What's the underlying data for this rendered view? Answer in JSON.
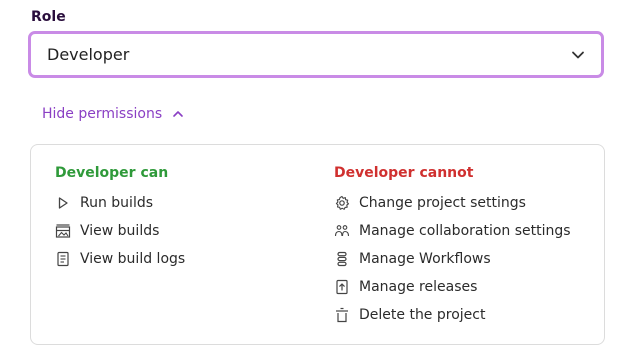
{
  "role": {
    "label": "Role",
    "selected": "Developer"
  },
  "toggle": {
    "label": "Hide permissions"
  },
  "permissions": {
    "can_heading": "Developer can",
    "cannot_heading": "Developer cannot",
    "can": [
      {
        "icon": "play-icon",
        "label": "Run builds"
      },
      {
        "icon": "builds-icon",
        "label": "View builds"
      },
      {
        "icon": "document-icon",
        "label": "View build logs"
      }
    ],
    "cannot": [
      {
        "icon": "gear-icon",
        "label": "Change project settings"
      },
      {
        "icon": "people-icon",
        "label": "Manage collaboration settings"
      },
      {
        "icon": "workflow-icon",
        "label": "Manage Workflows"
      },
      {
        "icon": "release-icon",
        "label": "Manage releases"
      },
      {
        "icon": "trash-icon",
        "label": "Delete the project"
      }
    ]
  },
  "colors": {
    "accent": "#8a3fc4",
    "focus_border": "#c98be6",
    "can": "#2f9a3a",
    "cannot": "#d0302f"
  }
}
